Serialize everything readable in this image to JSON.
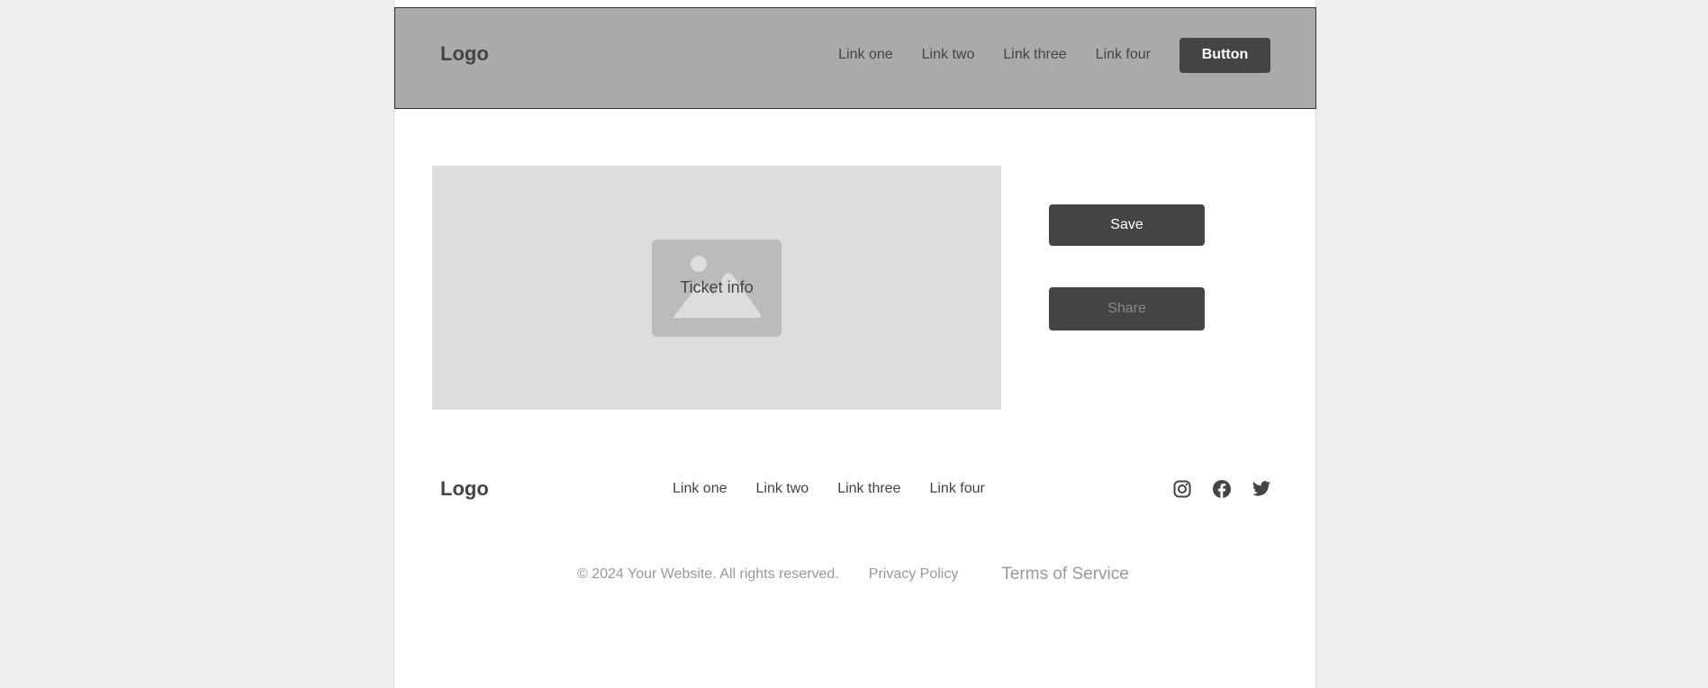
{
  "header": {
    "logo": "Logo",
    "links": [
      "Link one",
      "Link two",
      "Link three",
      "Link four"
    ],
    "button_label": "Button"
  },
  "main": {
    "image_label": "Ticket info",
    "save_label": "Save",
    "share_label": "Share"
  },
  "footer": {
    "logo": "Logo",
    "links": [
      "Link one",
      "Link two",
      "Link three",
      "Link four"
    ],
    "social_icons": [
      "instagram-icon",
      "facebook-icon",
      "twitter-icon"
    ],
    "copyright": "© 2024 Your Website. All rights reserved.",
    "privacy_label": "Privacy Policy",
    "terms_label": "Terms of Service"
  },
  "colors": {
    "page_background": "#eeeeee",
    "header_background": "#aaaaaa",
    "button_background": "#444444",
    "image_background": "#dddddd",
    "placeholder_background": "#bbbbbb"
  }
}
